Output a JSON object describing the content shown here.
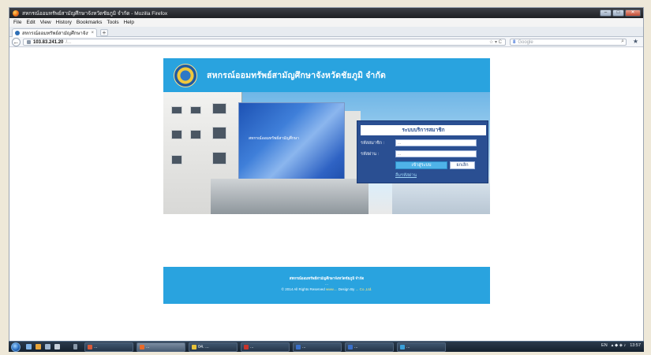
{
  "window": {
    "title": "สหกรณ์ออมทรัพย์สามัญศึกษาจังหวัดชัยภูมิ จำกัด - Mozilla Firefox",
    "controls": {
      "minimize": "–",
      "maximize": "□",
      "close": "✕"
    }
  },
  "menu": [
    "File",
    "Edit",
    "View",
    "History",
    "Bookmarks",
    "Tools",
    "Help"
  ],
  "tab": {
    "label": "สหกรณ์ออมทรัพย์สามัญศึกษาจังห...",
    "close": "×",
    "new_tab": "+"
  },
  "nav": {
    "back": "←",
    "url_host": "103.83.241.20",
    "url_path": "/...",
    "url_tools": "☆ ▾ C",
    "search_engine": "8",
    "search_placeholder": "Google",
    "search_icon": "⌕",
    "bookmark_star": "★"
  },
  "site": {
    "title": "สหกรณ์ออมทรัพย์สามัญศึกษาจังหวัดชัยภูมิ จำกัด",
    "banner_sign": "สหกรณ์ออมทรัพย์สามัญศึกษา",
    "login": {
      "heading": "ระบบบริการสมาชิก",
      "member_label": "รหัสสมาชิก :",
      "member_placeholder": "...",
      "password_label": "รหัสผ่าน :",
      "password_placeholder": "...",
      "login_button": "เข้าสู่ระบบ",
      "cancel_button": "ยกเลิก",
      "forgot_link": "ลืมรหัสผ่าน"
    },
    "footer": {
      "line1": "สหกรณ์ออมทรัพย์สามัญศึกษาจังหวัดชัยภูมิ จำกัด",
      "line2": "...",
      "copyright": "© 2014 All Rights Reserved",
      "site_link": "www....",
      "design_label": "Design By",
      "designer": "... Co.,Ltd."
    }
  },
  "taskbar": {
    "items": [
      {
        "label": "...",
        "color": "#d85a3a"
      },
      {
        "label": "...",
        "color": "#e86a2a"
      },
      {
        "label": "04. ...",
        "color": "#e8c23a"
      },
      {
        "label": "...",
        "color": "#c8342c"
      },
      {
        "label": "...",
        "color": "#3a6fc8"
      },
      {
        "label": "...",
        "color": "#3a6fc8"
      },
      {
        "label": "...",
        "color": "#3a9fd8"
      }
    ],
    "tray_lang": "EN",
    "clock": "13:57"
  },
  "colors": {
    "site_blue": "#29a3df",
    "panel_navy": "#2a4f92",
    "button_blue": "#4fb3e8"
  }
}
